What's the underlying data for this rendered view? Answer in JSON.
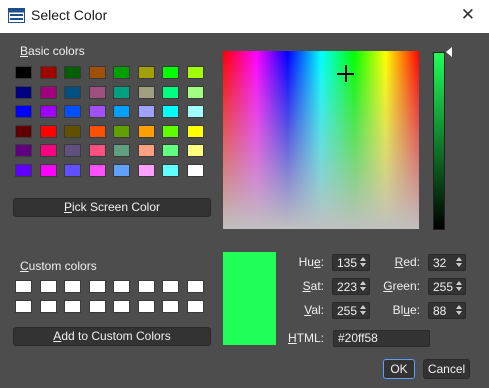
{
  "window": {
    "title": "Select Color",
    "close_glyph": "✕"
  },
  "basic_colors": {
    "label_first": "B",
    "label_rest": "asic colors",
    "swatches": [
      "#000000",
      "#a00000",
      "#006000",
      "#a05000",
      "#00a000",
      "#a0a000",
      "#00ff00",
      "#a0ff00",
      "#000080",
      "#a00080",
      "#005080",
      "#a05080",
      "#00a080",
      "#a0a080",
      "#00ff80",
      "#a0ff80",
      "#0000ff",
      "#a000ff",
      "#0050ff",
      "#a050ff",
      "#00a0ff",
      "#a0a0ff",
      "#00ffff",
      "#a0ffff",
      "#600000",
      "#ff0000",
      "#605000",
      "#ff5000",
      "#60a000",
      "#ffa000",
      "#60ff00",
      "#ffff00",
      "#600080",
      "#ff0080",
      "#605080",
      "#ff5080",
      "#60a080",
      "#ffa080",
      "#60ff80",
      "#ffff80",
      "#6000ff",
      "#ff00ff",
      "#6050ff",
      "#ff50ff",
      "#60a0ff",
      "#ffa0ff",
      "#60ffff",
      "#ffffff"
    ]
  },
  "pick_screen_button": {
    "u": "P",
    "rest": "ick Screen Color"
  },
  "custom_colors": {
    "label_first": "C",
    "label_rest": "ustom colors",
    "swatches": [
      "#ffffff",
      "#ffffff",
      "#ffffff",
      "#ffffff",
      "#ffffff",
      "#ffffff",
      "#ffffff",
      "#ffffff",
      "#ffffff",
      "#ffffff",
      "#ffffff",
      "#ffffff",
      "#ffffff",
      "#ffffff",
      "#ffffff",
      "#ffffff"
    ]
  },
  "add_custom_button": {
    "u": "A",
    "rest": "dd to Custom Colors"
  },
  "current_color": "#20ff58",
  "fields": {
    "hue": {
      "pre": "Hu",
      "u": "e",
      "post": ":",
      "value": "135"
    },
    "sat": {
      "pre": "",
      "u": "S",
      "post": "at:",
      "value": "223"
    },
    "val": {
      "pre": "",
      "u": "V",
      "post": "al:",
      "value": "255"
    },
    "red": {
      "pre": "",
      "u": "R",
      "post": "ed:",
      "value": "32"
    },
    "green": {
      "pre": "",
      "u": "G",
      "post": "reen:",
      "value": "255"
    },
    "blue": {
      "pre": "Bl",
      "u": "u",
      "post": "e:",
      "value": "88"
    },
    "html": {
      "pre": "",
      "u": "H",
      "post": "TML:",
      "value": "#20ff58"
    }
  },
  "buttons": {
    "ok": "OK",
    "cancel": "Cancel"
  },
  "icons": {
    "app": "window-icon",
    "close": "close-icon"
  }
}
